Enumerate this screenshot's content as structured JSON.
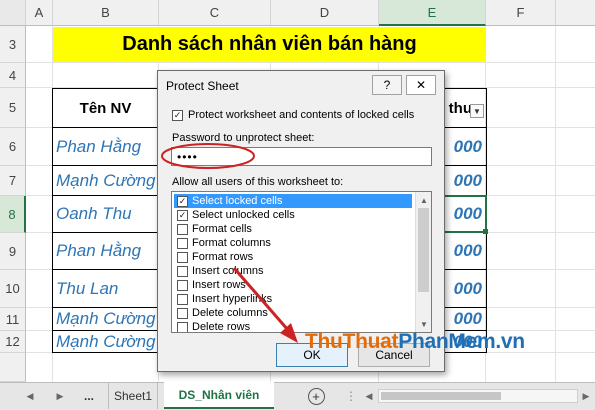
{
  "columns": [
    "A",
    "B",
    "C",
    "D",
    "E",
    "F"
  ],
  "rows": [
    "3",
    "4",
    "5",
    "6",
    "7",
    "8",
    "9",
    "10",
    "11",
    "12"
  ],
  "title": "Danh sách nhân viên bán hàng",
  "header": {
    "ten_nv": "Tên NV",
    "doanh_thu_partial": "thu"
  },
  "names": [
    "Phan Hằng",
    "Mạnh Cường",
    "Oanh Thu",
    "Phan Hằng",
    "Thu Lan",
    "Mạnh Cường",
    "Mạnh Cường"
  ],
  "amounts": [
    "000",
    "000",
    "000",
    "000",
    "000",
    "000",
    "000"
  ],
  "dialog": {
    "title": "Protect Sheet",
    "help": "?",
    "close": "✕",
    "protect_label": "Protect worksheet and contents of locked cells",
    "password_label": "Password to unprotect sheet:",
    "password_value": "••••",
    "allow_label": "Allow all users of this worksheet to:",
    "options": [
      {
        "label": "Select locked cells",
        "checked": true,
        "selected": true
      },
      {
        "label": "Select unlocked cells",
        "checked": true,
        "selected": false
      },
      {
        "label": "Format cells",
        "checked": false,
        "selected": false
      },
      {
        "label": "Format columns",
        "checked": false,
        "selected": false
      },
      {
        "label": "Format rows",
        "checked": false,
        "selected": false
      },
      {
        "label": "Insert columns",
        "checked": false,
        "selected": false
      },
      {
        "label": "Insert rows",
        "checked": false,
        "selected": false
      },
      {
        "label": "Insert hyperlinks",
        "checked": false,
        "selected": false
      },
      {
        "label": "Delete columns",
        "checked": false,
        "selected": false
      },
      {
        "label": "Delete rows",
        "checked": false,
        "selected": false
      }
    ],
    "ok": "OK",
    "cancel": "Cancel"
  },
  "tabs": {
    "ellipsis": "...",
    "sheet1": "Sheet1",
    "active": "DS_Nhân viên",
    "add": "+"
  },
  "watermark": {
    "part1": "ThuThuat",
    "part2": "PhanMem",
    "part3": ".vn"
  },
  "colors": {
    "title_fill": "#ffff00",
    "name_text": "#2e75b6",
    "selection": "#3399ff",
    "annotation": "#cc2222",
    "excel_green": "#217346"
  }
}
